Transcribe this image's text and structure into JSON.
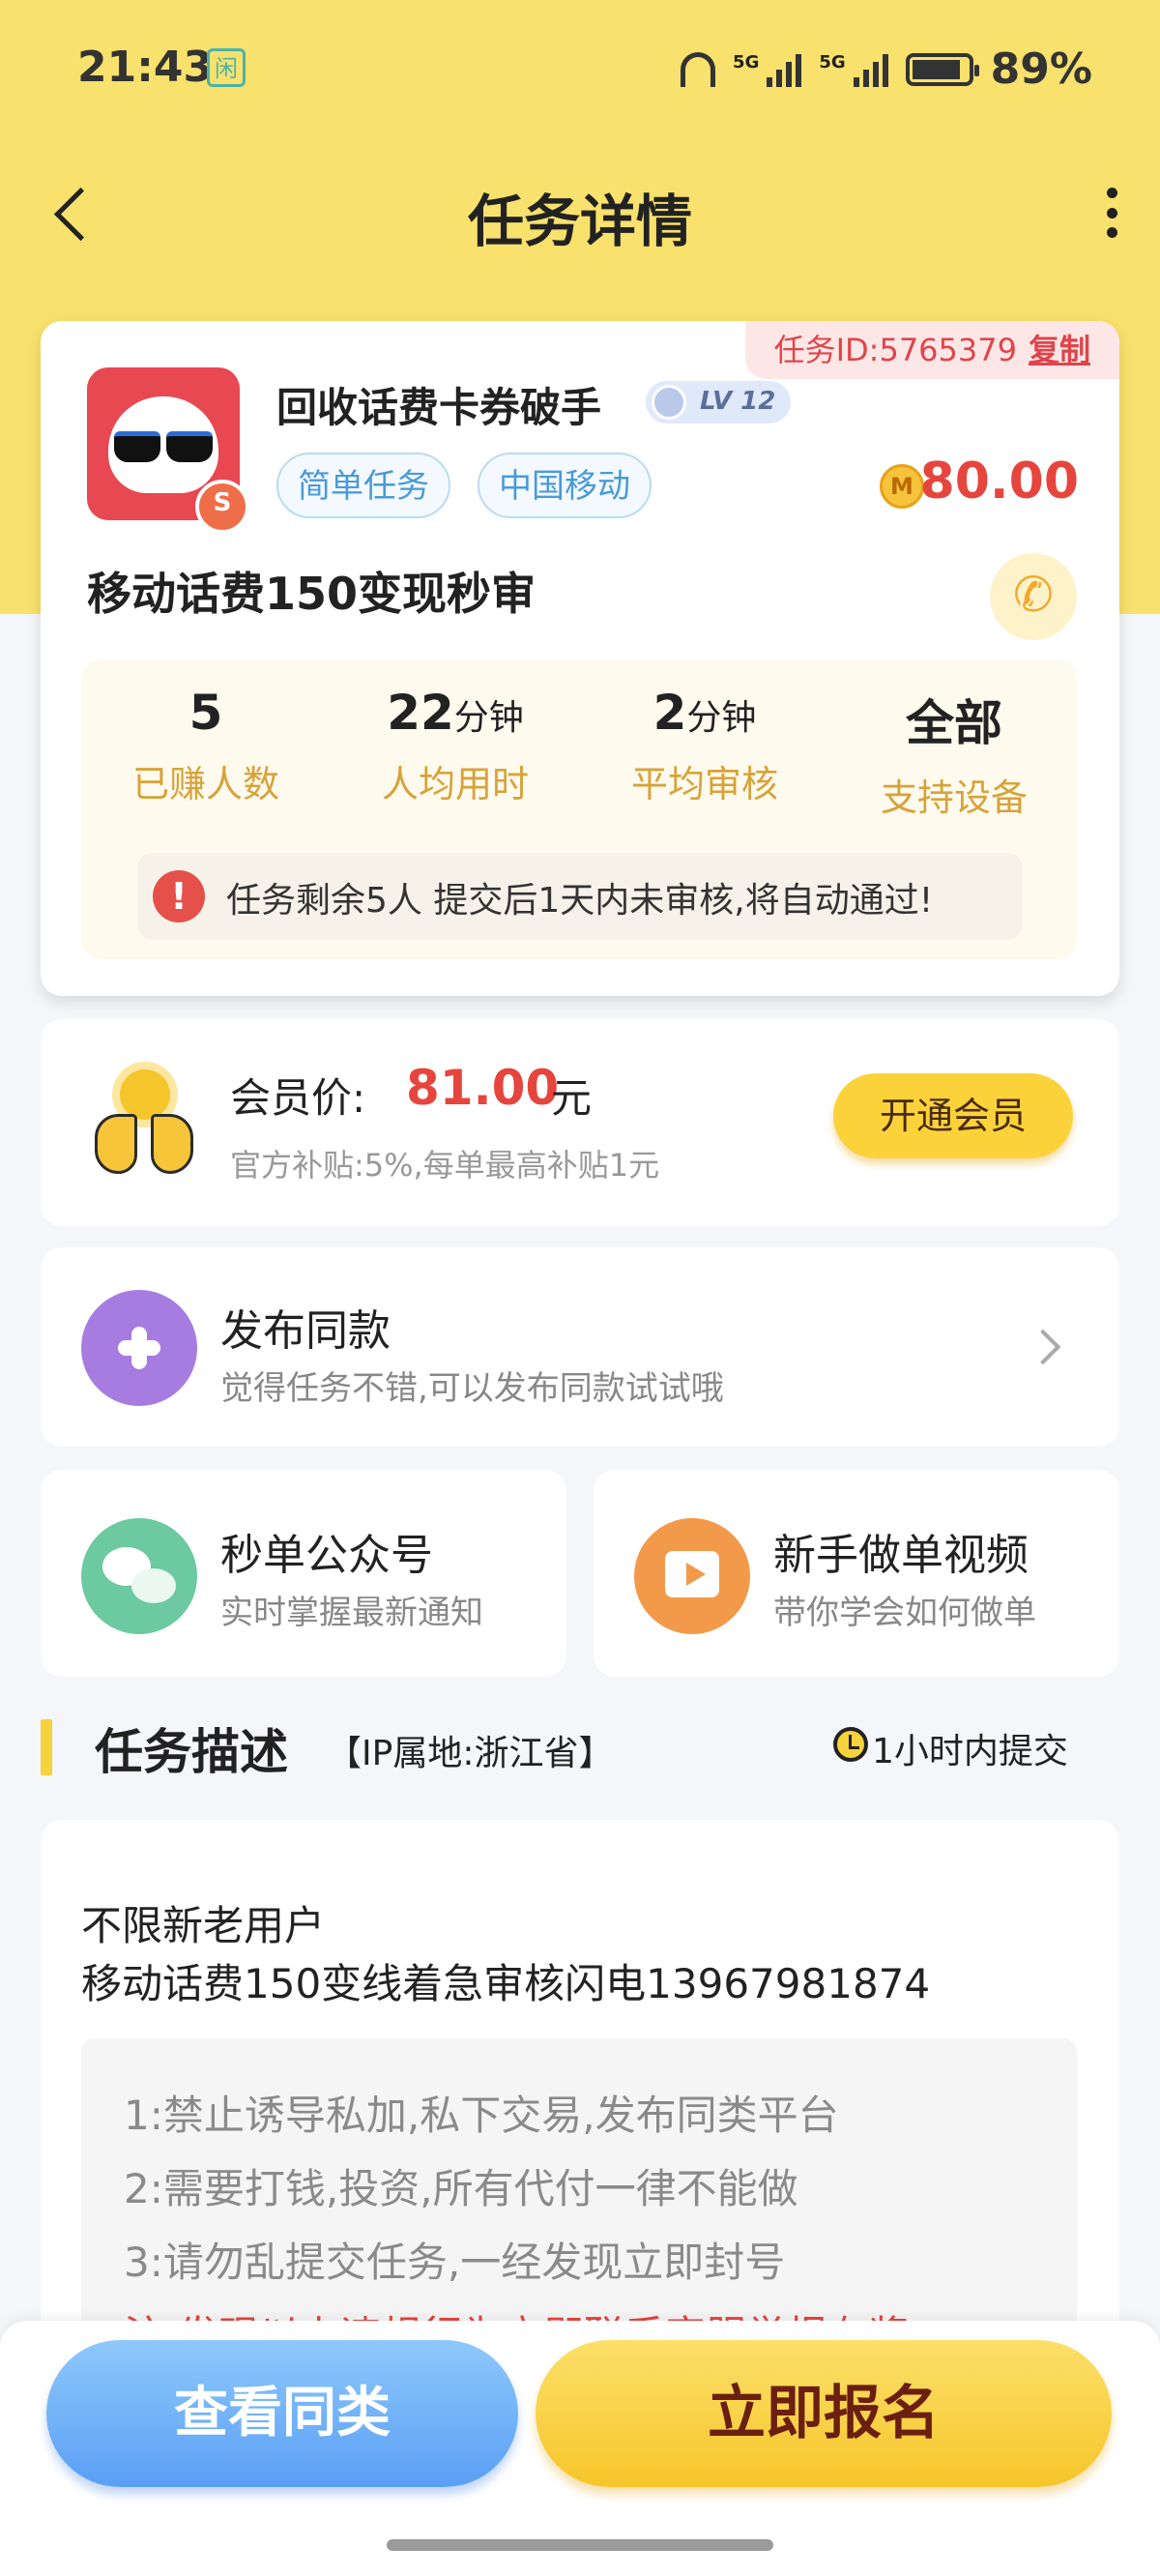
{
  "status_bar": {
    "time": "21:43",
    "app_badge": "闲",
    "network1": "5G",
    "network2": "5G",
    "battery": "89%"
  },
  "header": {
    "title": "任务详情"
  },
  "task": {
    "id_label": "任务ID:5765379",
    "copy_label": "复制",
    "shop_name": "回收话费卡券破手",
    "level": "LV 12",
    "tags": [
      "简单任务",
      "中国移动"
    ],
    "price": "80.00",
    "title": "移动话费150变现秒审",
    "stats": [
      {
        "value": "5",
        "unit": "",
        "label": "已赚人数"
      },
      {
        "value": "22",
        "unit": "分钟",
        "label": "人均用时"
      },
      {
        "value": "2",
        "unit": "分钟",
        "label": "平均审核"
      },
      {
        "value": "全部",
        "unit": "",
        "label": "支持设备"
      }
    ],
    "notice": "任务剩余5人  提交后1天内未审核,将自动通过!"
  },
  "member": {
    "label": "会员价:",
    "price": "81.00",
    "unit": "元",
    "sub": "官方补贴:5%,每单最高补贴1元",
    "button": "开通会员"
  },
  "publish": {
    "title": "发布同款",
    "sub": "觉得任务不错,可以发布同款试试哦"
  },
  "wechat": {
    "title": "秒单公众号",
    "sub": "实时掌握最新通知"
  },
  "video": {
    "title": "新手做单视频",
    "sub": "带你学会如何做单"
  },
  "description": {
    "section_title": "任务描述",
    "ip": "【IP属地:浙江省】",
    "deadline": "1小时内提交",
    "lines": [
      "不限新老用户",
      "移动话费150变线着急审核闪电13967981874"
    ],
    "rules": [
      "1:禁止诱导私加,私下交易,发布同类平台",
      "2:需要打钱,投资,所有代付一律不能做",
      "3:请勿乱提交任务,一经发现立即封号",
      "注:发现以上违规行为立即联系客服举报有奖"
    ]
  },
  "actions": {
    "similar": "查看同类",
    "signup": "立即报名"
  }
}
